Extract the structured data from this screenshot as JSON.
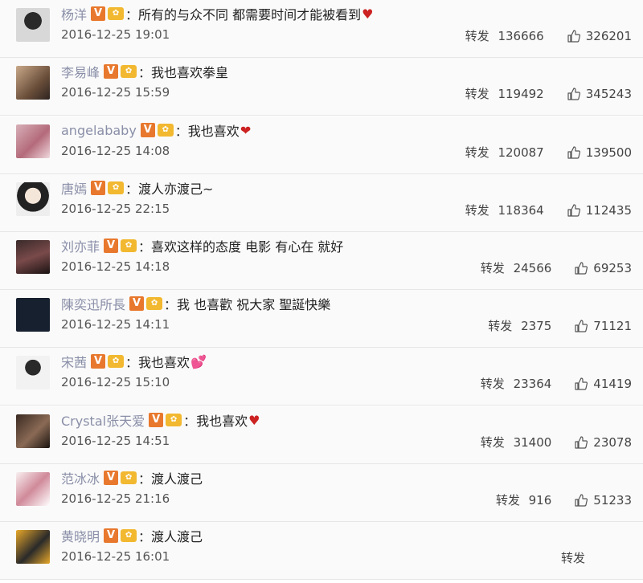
{
  "repost_label": "转发",
  "comments": [
    {
      "user": "杨洋",
      "text": "所有的与众不同 都需要时间才能被看到",
      "emoji": "♥",
      "time": "2016-12-25 19:01",
      "reposts": "136666",
      "likes": "326201"
    },
    {
      "user": "李易峰",
      "text": "我也喜欢拳皇",
      "emoji": "",
      "time": "2016-12-25 15:59",
      "reposts": "119492",
      "likes": "345243"
    },
    {
      "user": "angelababy",
      "text": "我也喜欢",
      "emoji": "❤",
      "time": "2016-12-25 14:08",
      "reposts": "120087",
      "likes": "139500"
    },
    {
      "user": "唐嫣",
      "text": "渡人亦渡己~",
      "emoji": "",
      "time": "2016-12-25 22:15",
      "reposts": "118364",
      "likes": "112435"
    },
    {
      "user": "刘亦菲",
      "text": "喜欢这样的态度 电影 有心在 就好",
      "emoji": "",
      "time": "2016-12-25 14:18",
      "reposts": "24566",
      "likes": "69253"
    },
    {
      "user": "陳奕迅所長",
      "text": "我 也喜歡 祝大家 聖誕快樂",
      "emoji": "",
      "time": "2016-12-25 14:11",
      "reposts": "2375",
      "likes": "71121"
    },
    {
      "user": "宋茜",
      "text": "我也喜欢",
      "emoji": "💕",
      "time": "2016-12-25 15:10",
      "reposts": "23364",
      "likes": "41419"
    },
    {
      "user": "Crystal张天爱",
      "text": "我也喜欢",
      "emoji": "♥",
      "time": "2016-12-25 14:51",
      "reposts": "31400",
      "likes": "23078"
    },
    {
      "user": "范冰冰",
      "text": "渡人渡己",
      "emoji": "",
      "time": "2016-12-25 21:16",
      "reposts": "916",
      "likes": "51233"
    },
    {
      "user": "黄晓明",
      "text": "渡人渡己",
      "emoji": "",
      "time": "2016-12-25 16:01",
      "reposts": "",
      "likes": ""
    }
  ],
  "badges": {
    "verified": "V"
  },
  "colors": {
    "username": "#8a8fa8",
    "verified_badge": "#e8782d",
    "level_badge": "#f2b830",
    "heart": "#c22222"
  },
  "icons": {
    "like": "thumbs-up-icon",
    "verified": "verified-v-icon",
    "level": "level-badge-icon"
  }
}
